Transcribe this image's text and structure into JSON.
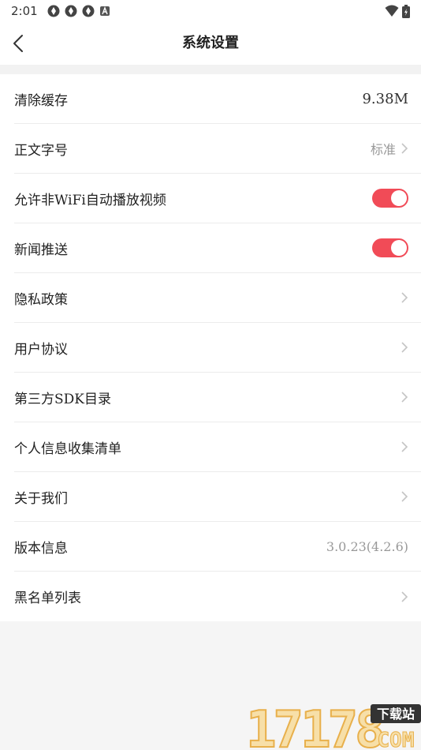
{
  "status": {
    "time": "2:01",
    "icons": [
      "circle-app-icon",
      "circle-app-icon",
      "circle-app-icon",
      "a-badge-icon"
    ],
    "right_icons": [
      "wifi-icon",
      "battery-icon"
    ]
  },
  "header": {
    "title": "系统设置",
    "back_icon": "chevron-left-icon"
  },
  "settings": {
    "clear_cache": {
      "label": "清除缓存",
      "value": "9.38M"
    },
    "font_size": {
      "label": "正文字号",
      "value": "标准"
    },
    "autoplay": {
      "label": "允许非WiFi自动播放视频",
      "on": true
    },
    "news_push": {
      "label": "新闻推送",
      "on": true
    },
    "privacy": {
      "label": "隐私政策"
    },
    "user_agreement": {
      "label": "用户协议"
    },
    "sdk_list": {
      "label": "第三方SDK目录"
    },
    "personal_info": {
      "label": "个人信息收集清单"
    },
    "about": {
      "label": "关于我们"
    },
    "version": {
      "label": "版本信息",
      "value": "3.0.23(4.2.6)"
    },
    "blacklist": {
      "label": "黑名单列表"
    }
  },
  "watermark": {
    "digits": "17178",
    "tag": "下载站",
    "domain": "COM"
  },
  "colors": {
    "accent": "#f14b57",
    "divider": "#ececec",
    "background": "#f5f5f5"
  }
}
